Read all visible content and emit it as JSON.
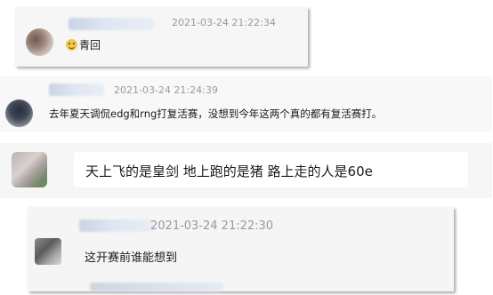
{
  "comments": [
    {
      "timestamp": "2021-03-24 21:22:34",
      "emoji_icon": "smiley-icon",
      "text": "青回"
    },
    {
      "timestamp": "2021-03-24 21:24:39",
      "text": "去年夏天调侃edg和rng打复活赛，没想到今年这两个真的都有复活赛打。"
    },
    {
      "text": "天上飞的是皇剑 地上跑的是猪 路上走的人是60e"
    },
    {
      "timestamp": "2021-03-24 21:22:30",
      "text": "这开赛前谁能想到"
    }
  ],
  "colors": {
    "card_bg": "#f5f5f5",
    "timestamp": "#9a9a9a",
    "text": "#1a1a1a",
    "name_blur": "#d6deeb"
  }
}
